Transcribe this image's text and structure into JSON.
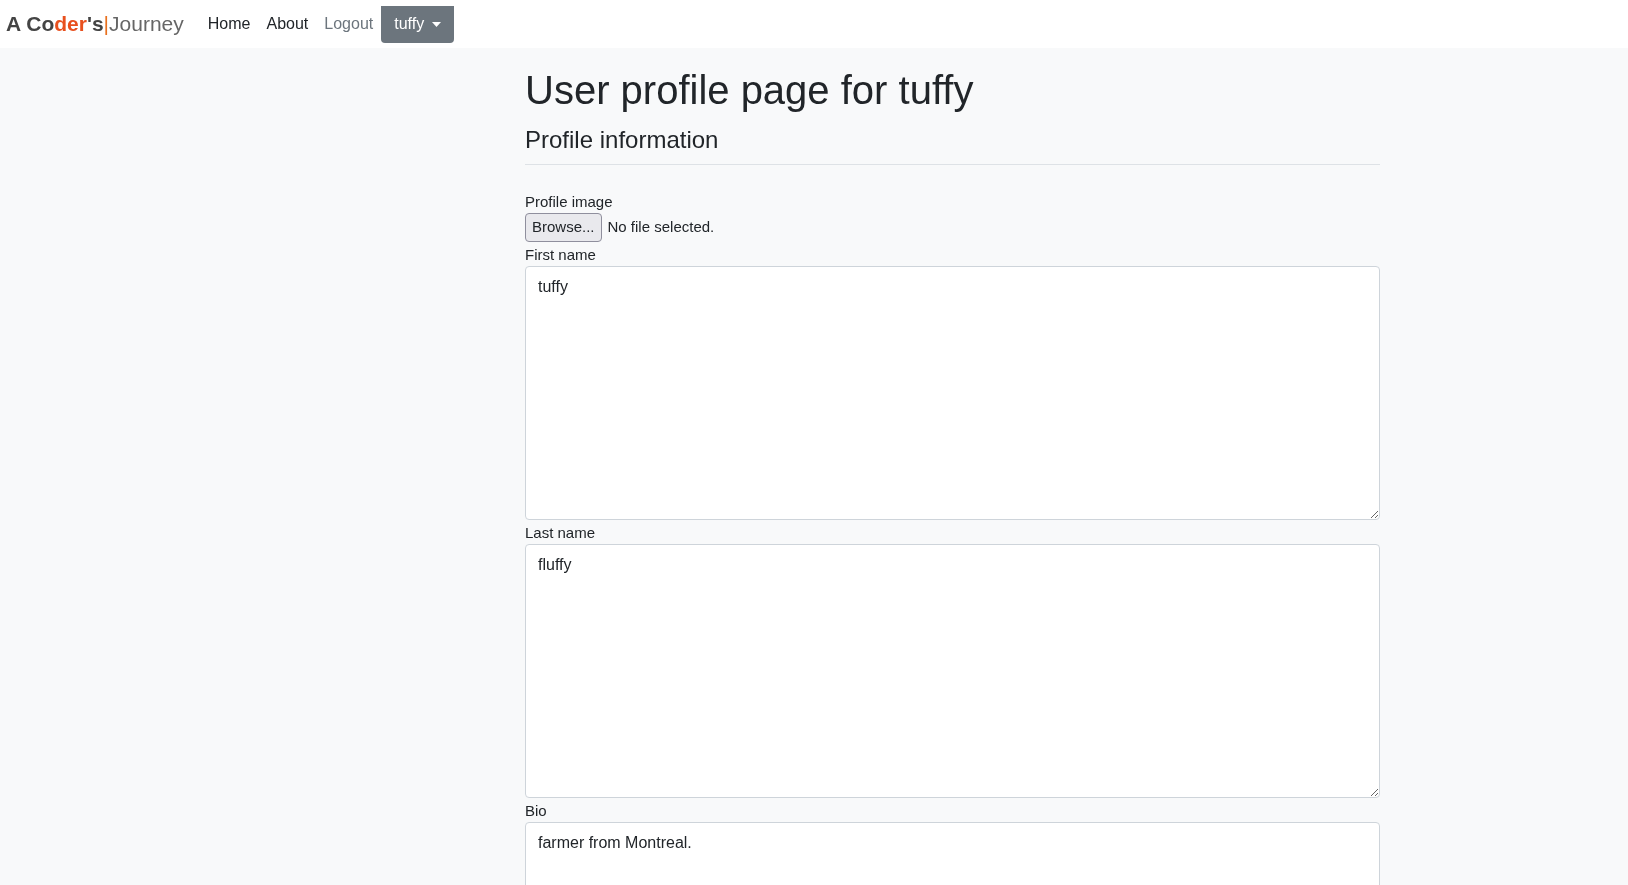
{
  "navbar": {
    "brand": [
      {
        "text": "A Co",
        "kind": "bold"
      },
      {
        "text": "der",
        "kind": "accent"
      },
      {
        "text": "'s",
        "kind": "bold"
      },
      {
        "text": "|",
        "kind": "bar"
      },
      {
        "text": "Journey",
        "kind": "light"
      }
    ],
    "links": [
      {
        "label": "Home",
        "dimmed": false
      },
      {
        "label": "About",
        "dimmed": false
      },
      {
        "label": "Logout",
        "dimmed": true
      }
    ],
    "user_menu": {
      "label": "tuffy"
    }
  },
  "title": "User profile page for tuffy",
  "section": "Profile information",
  "fields": [
    {
      "kind": "file",
      "label": "Profile image",
      "button": "Browse...",
      "status": "No file selected."
    },
    {
      "kind": "textarea",
      "label": "First name",
      "value": "tuffy"
    },
    {
      "kind": "textarea",
      "label": "Last name",
      "value": "fluffy"
    },
    {
      "kind": "textarea",
      "label": "Bio",
      "value": "farmer from Montreal."
    }
  ]
}
